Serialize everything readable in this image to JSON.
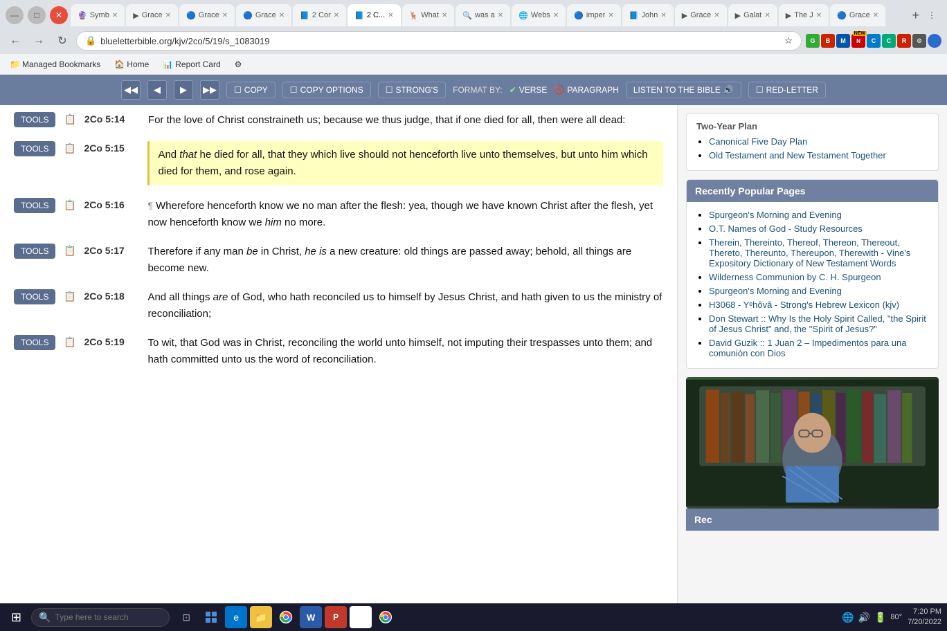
{
  "browser": {
    "tabs": [
      {
        "id": "syb",
        "label": "Symb",
        "color": "#9933cc",
        "favicon": "🔮",
        "active": false
      },
      {
        "id": "grace1",
        "label": "Grace",
        "color": "#ff0000",
        "favicon": "▶",
        "active": false
      },
      {
        "id": "grace2",
        "label": "Grace",
        "color": "#3366cc",
        "favicon": "🔵",
        "active": false
      },
      {
        "id": "grace3",
        "label": "Grace",
        "color": "#3366cc",
        "favicon": "🔵",
        "active": false
      },
      {
        "id": "2cor",
        "label": "2 Cor",
        "color": "#3366cc",
        "favicon": "📘",
        "active": false
      },
      {
        "id": "current",
        "label": "2 C...",
        "color": "#3366cc",
        "favicon": "📘",
        "active": true
      },
      {
        "id": "what",
        "label": "What",
        "color": "#ff8800",
        "favicon": "🦌",
        "active": false
      },
      {
        "id": "was",
        "label": "was a",
        "color": "#4285f4",
        "favicon": "🔍",
        "active": false
      },
      {
        "id": "web",
        "label": "Webs",
        "color": "#5599ff",
        "favicon": "🌐",
        "active": false
      },
      {
        "id": "imp",
        "label": "imper",
        "color": "#2255aa",
        "favicon": "🔵",
        "active": false
      },
      {
        "id": "john",
        "label": "John",
        "color": "#3366cc",
        "favicon": "📘",
        "active": false
      },
      {
        "id": "grace4",
        "label": "Grace",
        "color": "#ff0000",
        "favicon": "▶",
        "active": false
      },
      {
        "id": "galat",
        "label": "Galat",
        "color": "#ff0000",
        "favicon": "▶",
        "active": false
      },
      {
        "id": "thej",
        "label": "The J",
        "color": "#ff0000",
        "favicon": "▶",
        "active": false
      },
      {
        "id": "grace5",
        "label": "Grace",
        "color": "#2255aa",
        "favicon": "🔵",
        "active": false
      }
    ],
    "address": "blueletterbible.org/kjv/2co/5/19/s_1083019",
    "bookmarks": [
      {
        "label": "Managed Bookmarks"
      },
      {
        "label": "Home"
      },
      {
        "label": "Report Card"
      },
      {
        "label": "⚙"
      }
    ]
  },
  "toolbar": {
    "nav_prev_prev": "◀◀",
    "nav_prev": "◀",
    "nav_next": "▶",
    "nav_next_next": "▶▶",
    "copy": "COPY",
    "copy_options": "COPY OPTIONS",
    "strongs": "STRONG'S",
    "format_by": "FORMAT BY:",
    "verse": "VERSE",
    "paragraph": "PARAGRAPH",
    "listen": "LISTEN TO THE BIBLE",
    "red_letter": "RED-LETTER"
  },
  "verses": [
    {
      "ref": "2Co 5:14",
      "text": "For the love of Christ constraineth us; because we thus judge, that if one died for all, then were all dead:",
      "highlight": false,
      "para_mark": false
    },
    {
      "ref": "2Co 5:15",
      "text_parts": [
        {
          "text": "And ",
          "italic": false
        },
        {
          "text": "that",
          "italic": true
        },
        {
          "text": " he died for all, that they which live should not henceforth live unto themselves, but unto him which died for them, and rose again.",
          "italic": false
        }
      ],
      "highlight": true,
      "para_mark": false
    },
    {
      "ref": "2Co 5:16",
      "text": "Wherefore henceforth know we no man after the flesh: yea, though we have known Christ after the flesh, yet now henceforth know we ",
      "text_italic": "him",
      "text_after": " no more.",
      "highlight": false,
      "para_mark": true
    },
    {
      "ref": "2Co 5:17",
      "text_parts": [
        {
          "text": "Therefore if any man ",
          "italic": false
        },
        {
          "text": "be",
          "italic": true
        },
        {
          "text": " in Christ, ",
          "italic": false
        },
        {
          "text": "he is",
          "italic": true
        },
        {
          "text": " a new creature: old things are passed away; behold, all things are become new.",
          "italic": false
        }
      ],
      "highlight": false,
      "para_mark": false
    },
    {
      "ref": "2Co 5:18",
      "text_parts": [
        {
          "text": "And all things ",
          "italic": false
        },
        {
          "text": "are",
          "italic": true
        },
        {
          "text": " of God, who hath reconciled us to himself by Jesus Christ, and hath given to us the ministry of reconciliation;",
          "italic": false
        }
      ],
      "highlight": false,
      "para_mark": false
    },
    {
      "ref": "2Co 5:19",
      "text": "To wit, that God was in Christ, reconciling the world unto himself, not imputing their trespasses unto them; and hath committed unto us the word of reconciliation.",
      "highlight": false,
      "para_mark": false
    }
  ],
  "sidebar": {
    "two_year_plan": {
      "header": "Two-Year Plan",
      "items": [
        "Canonical Five Day Plan",
        "Old Testament and New Testament Together"
      ]
    },
    "recently_popular": {
      "header": "Recently Popular Pages",
      "items": [
        "Spurgeon's Morning and Evening",
        "O.T. Names of God - Study Resources",
        "Therein, Thereinto, Thereof, Thereon, Thereout, Thereto, Thereunto, Thereupon, Therewith - Vine's Expository Dictionary of New Testament Words",
        "Wilderness Communion by C. H. Spurgeon",
        "Spurgeon's Morning and Evening",
        "H3068 - Yᵉhôvâ - Strong's Hebrew Lexicon (kjv)",
        "Don Stewart :: Why Is the Holy Spirit Called, \"the Spirit of Jesus Christ\" and, the \"Spirit of Jesus?\"",
        "David Guzik :: 1 Juan 2 – Impedimentos para una comunión con Dios"
      ]
    },
    "recently_label": "Rec"
  },
  "taskbar": {
    "search_placeholder": "Type here to search",
    "time": "7:20 PM",
    "date": "7/20/2022",
    "temperature": "80°"
  }
}
